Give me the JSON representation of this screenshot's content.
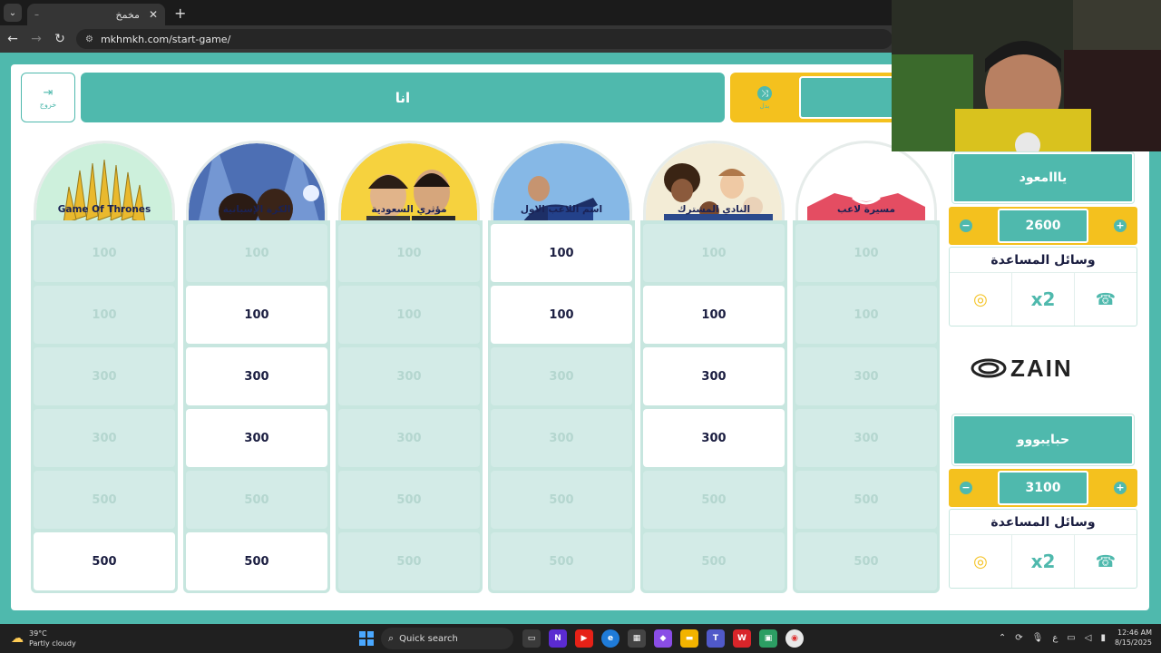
{
  "browser": {
    "tab_title": "مخمخ",
    "tab_close": "✕",
    "new_tab": "+",
    "url": "mkhmkh.com/start-game/"
  },
  "header": {
    "exit_label": "خروج",
    "current_turn": "انا",
    "switch_label": "بدل"
  },
  "categories": [
    {
      "name": "Game Of Thrones",
      "cells": [
        {
          "v": "100",
          "s": "used"
        },
        {
          "v": "100",
          "s": "used"
        },
        {
          "v": "300",
          "s": "used"
        },
        {
          "v": "300",
          "s": "used"
        },
        {
          "v": "500",
          "s": "used"
        },
        {
          "v": "500",
          "s": "open"
        }
      ]
    },
    {
      "name": "الكرة الإسبانية",
      "cells": [
        {
          "v": "100",
          "s": "used"
        },
        {
          "v": "100",
          "s": "open"
        },
        {
          "v": "300",
          "s": "open"
        },
        {
          "v": "300",
          "s": "open"
        },
        {
          "v": "500",
          "s": "used"
        },
        {
          "v": "500",
          "s": "open"
        }
      ]
    },
    {
      "name": "مؤثري السعودية",
      "cells": [
        {
          "v": "100",
          "s": "used"
        },
        {
          "v": "100",
          "s": "used"
        },
        {
          "v": "300",
          "s": "used"
        },
        {
          "v": "300",
          "s": "used"
        },
        {
          "v": "500",
          "s": "used"
        },
        {
          "v": "500",
          "s": "used"
        }
      ]
    },
    {
      "name": "اسم اللاعب الاول",
      "cells": [
        {
          "v": "100",
          "s": "open"
        },
        {
          "v": "100",
          "s": "open"
        },
        {
          "v": "300",
          "s": "used"
        },
        {
          "v": "300",
          "s": "used"
        },
        {
          "v": "500",
          "s": "used"
        },
        {
          "v": "500",
          "s": "used"
        }
      ]
    },
    {
      "name": "النادي المشترك",
      "cells": [
        {
          "v": "100",
          "s": "used"
        },
        {
          "v": "100",
          "s": "open"
        },
        {
          "v": "300",
          "s": "open"
        },
        {
          "v": "300",
          "s": "open"
        },
        {
          "v": "500",
          "s": "used"
        },
        {
          "v": "500",
          "s": "used"
        }
      ]
    },
    {
      "name": "مسيرة لاعب",
      "cells": [
        {
          "v": "100",
          "s": "used"
        },
        {
          "v": "100",
          "s": "used"
        },
        {
          "v": "300",
          "s": "used"
        },
        {
          "v": "300",
          "s": "used"
        },
        {
          "v": "500",
          "s": "used"
        },
        {
          "v": "500",
          "s": "used"
        }
      ]
    }
  ],
  "teams": [
    {
      "name": "يااامعود",
      "score": "2600",
      "help_title": "وسائل المساعدة"
    },
    {
      "name": "حبايبووو",
      "score": "3100",
      "help_title": "وسائل المساعدة"
    }
  ],
  "score_plus": "+",
  "score_minus": "−",
  "x2_label": "x2",
  "sponsor": "ZAIN",
  "taskbar": {
    "temp": "39°C",
    "weather": "Partly cloudy",
    "search": "Quick search",
    "lang": "ع",
    "time": "12:46 AM",
    "date": "8/15/2025"
  },
  "colors": {
    "teal": "#4fb9ad",
    "yellow": "#f4c11e",
    "navy": "#1a1d40"
  }
}
